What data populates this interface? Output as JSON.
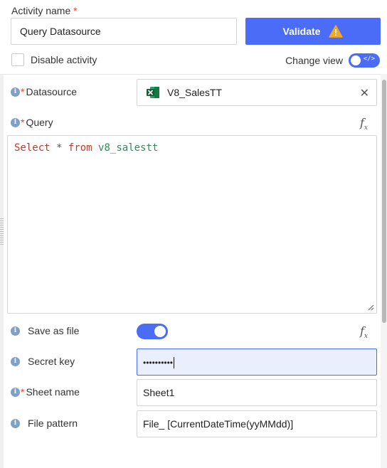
{
  "activity": {
    "label": "Activity name",
    "required_mark": "*",
    "value": "Query Datasource"
  },
  "validate": {
    "label": "Validate",
    "icon": "warning-icon",
    "color": "#4a6cf7",
    "warn_color": "#f5a623"
  },
  "disable_activity": {
    "label": "Disable activity",
    "checked": false
  },
  "change_view": {
    "label": "Change view",
    "toggle_on": true,
    "icon": "code-icon"
  },
  "datasource": {
    "label": "Datasource",
    "required_mark": "*",
    "value": "V8_SalesTT",
    "icon": "excel-icon",
    "clear_icon": "close-icon"
  },
  "query": {
    "label": "Query",
    "required_mark": "*",
    "fx": "f",
    "fx_sub": "x",
    "keyword_select": "Select",
    "operator": "*",
    "keyword_from": "from",
    "table": "v8_salestt"
  },
  "save_as_file": {
    "label": "Save as file",
    "toggle_on": true
  },
  "secret_key": {
    "label": "Secret key",
    "masked_value": "••••••••••"
  },
  "sheet_name": {
    "label": "Sheet name",
    "required_mark": "*",
    "value": "Sheet1"
  },
  "file_pattern": {
    "label": "File pattern",
    "value": "File_ [CurrentDateTime(yyMMdd)]"
  },
  "info_icon_text": "i"
}
